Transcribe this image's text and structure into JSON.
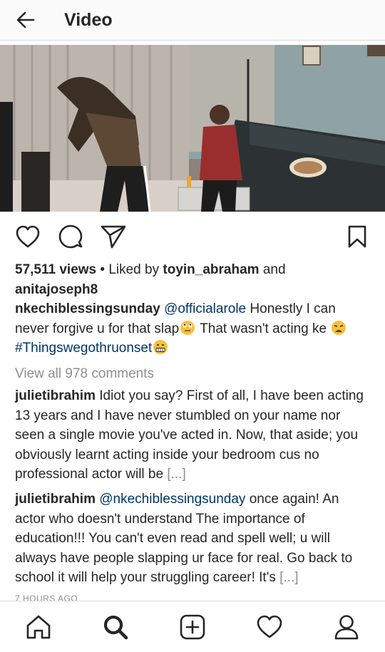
{
  "header": {
    "title": "Video"
  },
  "post": {
    "views_count": "57,511 views",
    "separator": "•",
    "liked_by_prefix": "Liked by",
    "liked_by_user": "toyin_abraham",
    "liked_by_and": "and",
    "liked_by_other": "anitajoseph8",
    "caption": {
      "author": "nkechiblessingsunday",
      "mention": "@officialarole",
      "text_part1": "Honestly I can never forgive u for that slap",
      "text_part2": "That wasn't acting ke",
      "hashtag": "#Thingswegothruonset"
    },
    "view_all_comments": "View all 978 comments",
    "comments": [
      {
        "author": "julietibrahim",
        "text": "Idiot you say? First of all, I have been acting 13 years and I have never stumbled on your name nor seen a single movie you've acted in. Now, that aside; you obviously learnt acting inside your bedroom cus no professional actor will be",
        "more": "[...]"
      },
      {
        "author": "julietibrahim",
        "mention": "@nkechiblessingsunday",
        "text": "once again! An actor who doesn't understand The importance of education!!! You can't even read and spell well; u will always have people slapping ur face for real. Go back to school it will help your struggling career! It's",
        "more": "[...]"
      }
    ],
    "timestamp": "7 HOURS AGO"
  },
  "icons": {
    "back": "arrow-left-icon",
    "like": "heart-outline-icon",
    "comment": "speech-bubble-icon",
    "share": "paper-plane-icon",
    "save": "bookmark-icon",
    "nav": [
      "home-icon",
      "search-icon",
      "add-post-icon",
      "activity-heart-icon",
      "profile-icon"
    ]
  },
  "colors": {
    "text": "#262626",
    "link": "#003569",
    "muted": "#8e8e8e",
    "border": "#dbdbdb"
  }
}
